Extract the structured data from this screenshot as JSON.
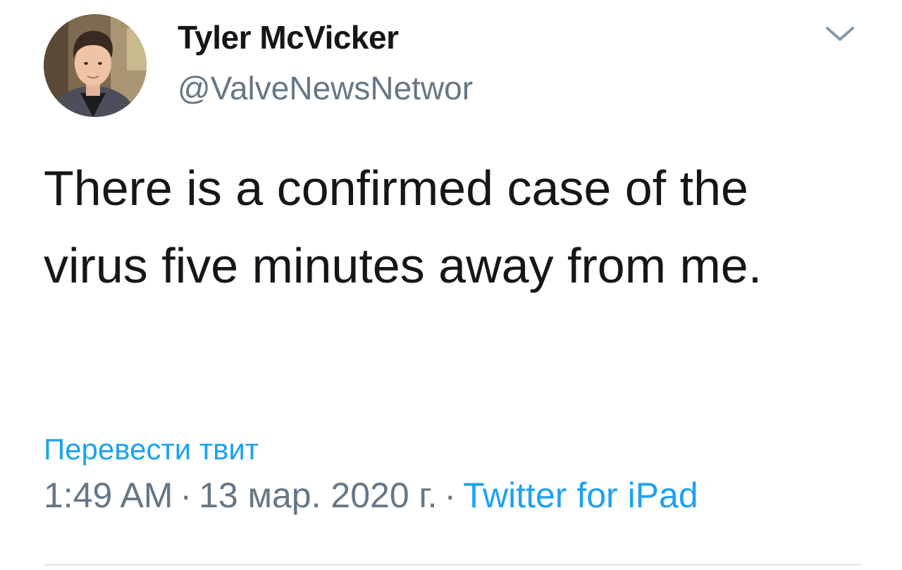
{
  "tweet": {
    "author": {
      "display_name": "Tyler McVicker",
      "handle": "@ValveNewsNetwor",
      "avatar_icon": "user-avatar-photo"
    },
    "menu_icon": "chevron-down-icon",
    "text": "There is a confirmed case of the virus five minutes away from me.",
    "translate_label": "Перевести твит",
    "time": "1:49 AM",
    "date": "13 мар. 2020 г.",
    "separator": "·",
    "source": "Twitter for iPad"
  },
  "colors": {
    "text": "#14171a",
    "secondary": "#657786",
    "link": "#1da1f2",
    "divider": "#e6ecf0"
  }
}
